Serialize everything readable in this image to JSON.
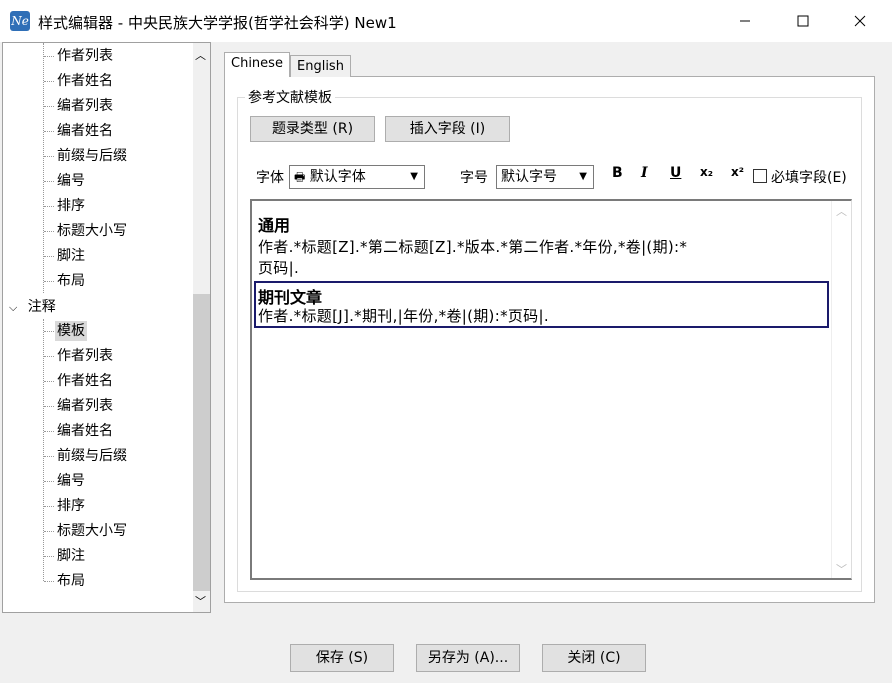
{
  "window": {
    "app_icon_text": "Ne",
    "title": "样式编辑器 - 中央民族大学学报(哲学社会科学) New1",
    "controls": [
      "minimize",
      "maximize",
      "close"
    ]
  },
  "tree": {
    "top_items": [
      "作者列表",
      "作者姓名",
      "编者列表",
      "编者姓名",
      "前缀与后缀",
      "编号",
      "排序",
      "标题大小写",
      "脚注",
      "布局"
    ],
    "section_label": "注释",
    "section_items": [
      "模板",
      "作者列表",
      "作者姓名",
      "编者列表",
      "编者姓名",
      "前缀与后缀",
      "编号",
      "排序",
      "标题大小写",
      "脚注",
      "布局"
    ],
    "selected": "模板"
  },
  "tabs": [
    {
      "label": "Chinese",
      "active": true
    },
    {
      "label": "English",
      "active": false
    }
  ],
  "group_title": "参考文献模板",
  "buttons": {
    "record_type": "题录类型 (R)",
    "insert_field": "插入字段 (I)"
  },
  "font_row": {
    "font_label": "字体",
    "font_value": "默认字体",
    "size_label": "字号",
    "size_value": "默认字号",
    "bold": "B",
    "italic": "I",
    "underline": "U",
    "subscript": "x₂",
    "superscript": "x²",
    "required_label": "必填字段(E)",
    "required_checked": false
  },
  "editor": {
    "entries": [
      {
        "title": "通用",
        "line1": "作者.*标题[Z].*第二标题[Z].*版本.*第二作者.*年份,*卷|(期):*",
        "line2": "页码|."
      },
      {
        "title": "期刊文章",
        "line1": "作者.*标题[J].*期刊,|年份,*卷|(期):*页码|."
      }
    ]
  },
  "footer": {
    "save": "保存 (S)",
    "save_as": "另存为 (A)...",
    "close": "关闭 (C)"
  },
  "colors": {
    "accent": "#0078d7",
    "selection_box": "#1a1a6b",
    "app_icon": "#2f6fb7"
  }
}
